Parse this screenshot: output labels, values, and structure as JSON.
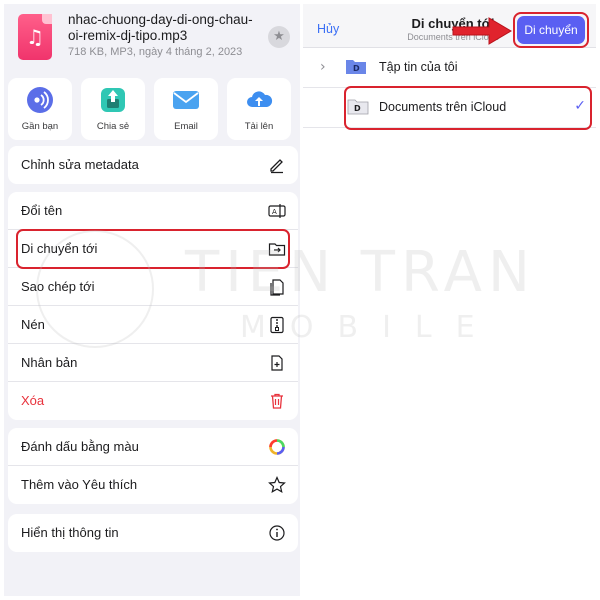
{
  "file": {
    "name": "nhac-chuong-day-di-ong-chau-oi-remix-dj-tipo.mp3",
    "meta": "718 KB, MP3, ngày 4 tháng 2, 2023"
  },
  "actions": [
    {
      "label": "Gần bạn",
      "icon": "airdrop-icon"
    },
    {
      "label": "Chia sẻ",
      "icon": "share-icon"
    },
    {
      "label": "Email",
      "icon": "mail-icon"
    },
    {
      "label": "Tải lên",
      "icon": "cloud-upload-icon"
    }
  ],
  "menu": {
    "metadata": "Chỉnh sửa metadata",
    "rename": "Đổi tên",
    "move_to": "Di chuyển tới",
    "copy_to": "Sao chép tới",
    "compress": "Nén",
    "duplicate": "Nhân bản",
    "delete": "Xóa",
    "color_tag": "Đánh dấu bằng màu",
    "add_favorite": "Thêm vào Yêu thích",
    "show_info": "Hiển thị thông tin"
  },
  "move_sheet": {
    "cancel": "Hủy",
    "title": "Di chuyển tới",
    "subtitle": "Documents trên iCloud",
    "move_button": "Di chuyển",
    "folders": [
      {
        "label": "Tập tin của tôi"
      },
      {
        "label": "Documents trên iCloud"
      }
    ]
  },
  "watermark": {
    "line1": "TIEN TRAN",
    "line2": "MOBILE"
  },
  "colors": {
    "accent": "#5a5ff2",
    "highlight": "#d9232e",
    "danger": "#e8323c",
    "link": "#3b6ff5"
  }
}
